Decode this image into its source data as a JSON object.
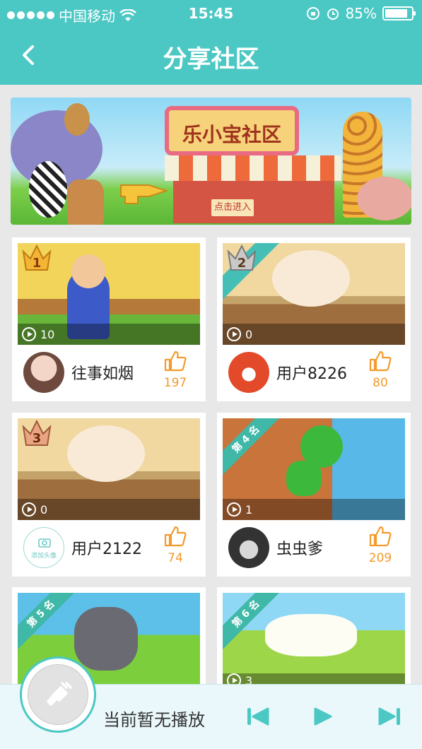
{
  "status_bar": {
    "carrier": "中国移动",
    "time": "15:45",
    "battery": "85%",
    "battery_level": 0.85
  },
  "nav": {
    "title": "分享社区"
  },
  "banner": {
    "sign": "乐小宝社区",
    "enter_label": "点击进入"
  },
  "cards": [
    {
      "rank_label": "1",
      "plays": "10",
      "user": "往事如烟",
      "likes": "197"
    },
    {
      "rank_label": "2",
      "plays": "0",
      "user": "用户8226",
      "likes": "80"
    },
    {
      "rank_label": "3",
      "plays": "0",
      "user": "用户2122",
      "likes": "74",
      "avatar_text": "添加头像"
    },
    {
      "rank_label": "第 4 名",
      "plays": "1",
      "user": "虫虫爹",
      "likes": "209"
    },
    {
      "rank_label": "第 5 名",
      "plays": "",
      "user": "",
      "likes": ""
    },
    {
      "rank_label": "第 6 名",
      "plays": "3",
      "user": "",
      "likes": ""
    }
  ],
  "player": {
    "status": "当前暂无播放"
  },
  "colors": {
    "accent": "#4bc8c4",
    "like": "#f39a2c"
  }
}
